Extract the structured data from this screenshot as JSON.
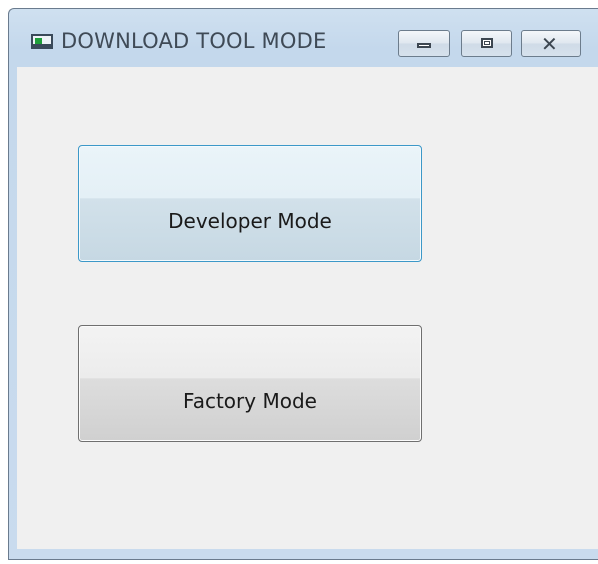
{
  "window": {
    "title": "DOWNLOAD TOOL MODE",
    "icon": "application-window-icon",
    "controls": {
      "minimize": "minimize-icon",
      "maximize": "maximize-icon",
      "close": "close-icon",
      "close_glyph": "✕"
    }
  },
  "buttons": {
    "developer_label": "Developer Mode",
    "factory_label": "Factory Mode"
  },
  "colors": {
    "focus_border": "#3c98c8",
    "client_background": "#f0f0f0",
    "frame": "#c9dbee"
  }
}
